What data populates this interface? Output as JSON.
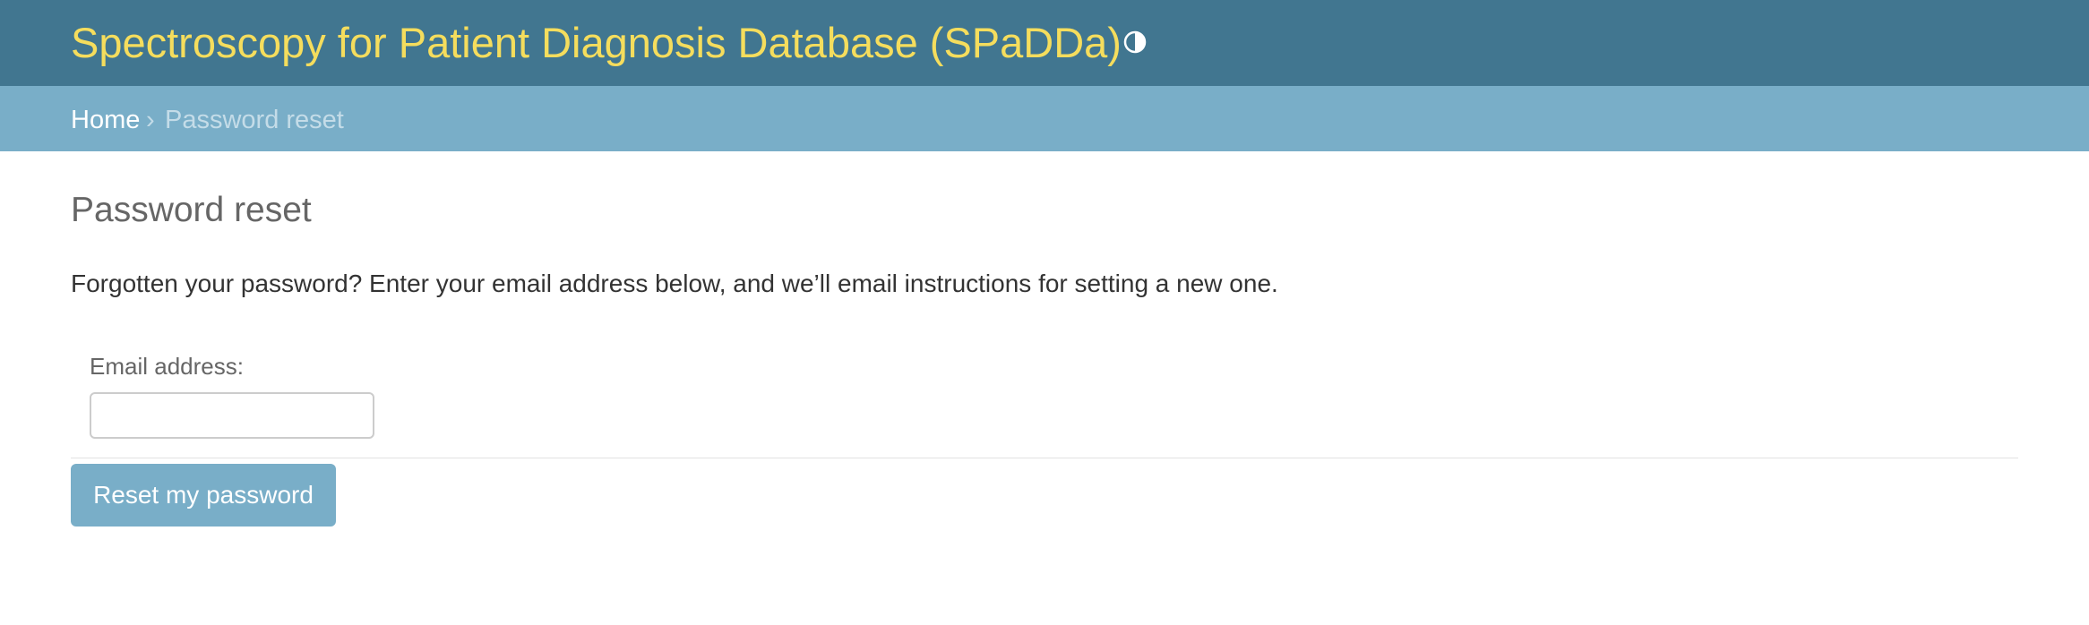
{
  "header": {
    "site_title": "Spectroscopy for Patient Diagnosis Database (SPaDDa)",
    "theme_toggle_icon": "contrast-icon"
  },
  "breadcrumbs": {
    "home_label": "Home",
    "separator": "›",
    "current_label": "Password reset"
  },
  "main": {
    "title": "Password reset",
    "intro_text": "Forgotten your password? Enter your email address below, and we’ll email instructions for setting a new one.",
    "email_label": "Email address:",
    "email_value": "",
    "submit_label": "Reset my password"
  },
  "colors": {
    "header_bg": "#417690",
    "site_title": "#f5dd5d",
    "breadcrumbs_bg": "#79aec8",
    "button_bg": "#79aec8"
  }
}
